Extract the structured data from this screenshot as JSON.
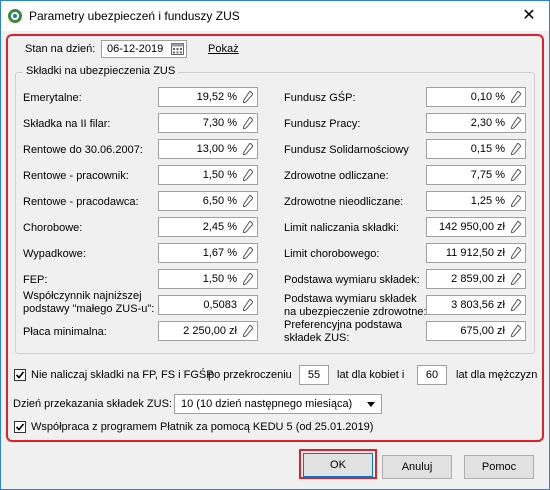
{
  "window": {
    "title": "Parametry ubezpieczeń i funduszy ZUS",
    "close": "✕"
  },
  "header": {
    "date_label": "Stan na dzień:",
    "date_value": "06-12-2019",
    "show_link": "Pokaż"
  },
  "group_title": "Składki na ubezpieczenia ZUS",
  "left_rows": [
    {
      "label": "Emerytalne:",
      "value": "19,52 %"
    },
    {
      "label": "Składka na II filar:",
      "value": "7,30 %"
    },
    {
      "label": "Rentowe do 30.06.2007:",
      "value": "13,00 %"
    },
    {
      "label": "Rentowe - pracownik:",
      "value": "1,50 %"
    },
    {
      "label": "Rentowe - pracodawca:",
      "value": "6,50 %"
    },
    {
      "label": "Chorobowe:",
      "value": "2,45 %"
    },
    {
      "label": "Wypadkowe:",
      "value": "1,67 %"
    },
    {
      "label": "FEP:",
      "value": "1,50 %"
    },
    {
      "label": "Współczynnik najniższej",
      "label2": "podstawy \"małego ZUS-u\":",
      "value": "0,5083"
    },
    {
      "label": "Płaca minimalna:",
      "value": "2 250,00 zł"
    }
  ],
  "right_rows": [
    {
      "label": "Fundusz GŚP:",
      "value": "0,10 %"
    },
    {
      "label": "Fundusz Pracy:",
      "value": "2,30 %"
    },
    {
      "label": "Fundusz Solidarnościowy",
      "value": "0,15 %"
    },
    {
      "label": "Zdrowotne odliczane:",
      "value": "7,75 %"
    },
    {
      "label": "Zdrowotne nieodliczane:",
      "value": "1,25 %"
    },
    {
      "label": "Limit naliczania składki:",
      "value": "142 950,00 zł"
    },
    {
      "label": "Limit chorobowego:",
      "value": "11 912,50 zł"
    },
    {
      "label": "Podstawa wymiaru składek:",
      "value": "2 859,00 zł"
    },
    {
      "label": "Podstawa wymiaru składek",
      "label2": "na ubezpieczenie zdrowotne:",
      "value": "3 803,56 zł"
    },
    {
      "label": "Preferencyjna podstawa",
      "label2": "składek ZUS:",
      "value": "675,00 zł"
    }
  ],
  "limit_row": {
    "checkbox_label": "Nie naliczaj składki na FP, FS i FGŚP",
    "after": "po przekroczeniu",
    "women_value": "55",
    "women_label": "lat dla kobiet i",
    "men_value": "60",
    "men_label": "lat dla mężczyzn"
  },
  "transfer": {
    "label": "Dzień przekazania składek ZUS:",
    "value": "10 (10 dzień następnego miesiąca)"
  },
  "platnik": {
    "label": "Współpraca z programem Płatnik za pomocą KEDU 5 (od 25.01.2019)"
  },
  "buttons": {
    "ok": "OK",
    "cancel": "Anuluj",
    "help": "Pomoc"
  }
}
